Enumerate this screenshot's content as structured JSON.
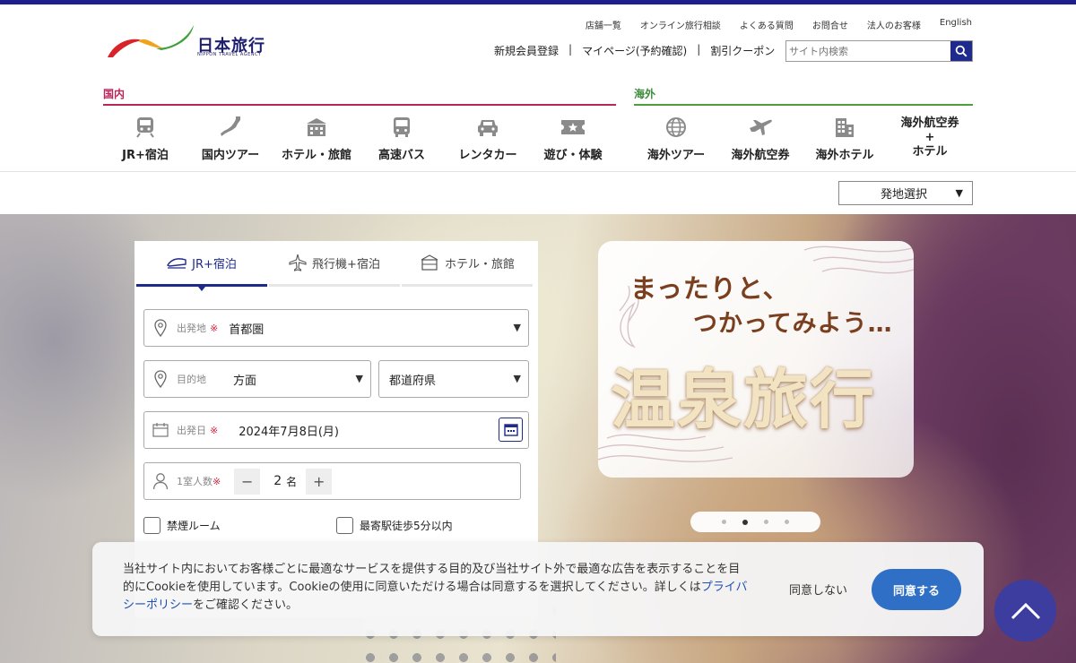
{
  "brand": {
    "name": "日本旅行",
    "sub": "NIPPON TRAVEL AGENCY"
  },
  "util_links": [
    "店舗一覧",
    "オンライン旅行相談",
    "よくある質問",
    "お問合せ",
    "法人のお客様",
    "English"
  ],
  "member_links": [
    "新規会員登録",
    "マイページ(予約確認)",
    "割引クーポン"
  ],
  "search": {
    "placeholder": "サイト内検索"
  },
  "nav": {
    "domestic_label": "国内",
    "intl_label": "海外",
    "domestic": [
      {
        "label": "JR+宿泊",
        "icon": "train-icon"
      },
      {
        "label": "国内ツアー",
        "icon": "japan-map-icon"
      },
      {
        "label": "ホテル・旅館",
        "icon": "hotel-icon"
      },
      {
        "label": "高速バス",
        "icon": "bus-icon"
      },
      {
        "label": "レンタカー",
        "icon": "car-icon"
      },
      {
        "label": "遊び・体験",
        "icon": "ticket-icon"
      }
    ],
    "intl": [
      {
        "label": "海外ツアー",
        "icon": "globe-icon"
      },
      {
        "label": "海外航空券",
        "icon": "airplane-icon"
      },
      {
        "label": "海外ホテル",
        "icon": "building-icon"
      },
      {
        "label": "海外航空券\n+\nホテル",
        "icon": ""
      }
    ]
  },
  "departure_select": {
    "value": "発地選択"
  },
  "search_panel": {
    "tabs": [
      "JR+宿泊",
      "飛行機+宿泊",
      "ホテル・旅館"
    ],
    "active_tab": 0,
    "departure": {
      "label": "出発地",
      "required": "※",
      "value": "首都圏"
    },
    "destination": {
      "label": "目的地",
      "area": "方面",
      "prefecture": "都道府県"
    },
    "date": {
      "label": "出発日",
      "required": "※",
      "value": "2024年7月8日(月)"
    },
    "guests": {
      "label": "1室人数",
      "required": "※",
      "count": "2",
      "unit": "名",
      "minus": "−",
      "plus": "+"
    },
    "options": [
      "禁煙ルーム",
      "最寄駅徒歩5分以内"
    ]
  },
  "banner": {
    "line1": "まったりと、",
    "line2": "つかってみよう…",
    "title": "温泉旅行"
  },
  "carousel": {
    "count": 4,
    "active": 1
  },
  "cookie": {
    "text": "当社サイト内においてお客様ごとに最適なサービスを提供する目的及び当社サイト外で最適な広告を表示することを目的にCookieを使用しています。Cookieの使用に同意いただける場合は同意するを選択してください。詳しくは",
    "link": "プライバシーポリシー",
    "text_after": "をご確認ください。",
    "decline": "同意しない",
    "accept": "同意する"
  },
  "colors": {
    "navy": "#1e2a8c",
    "domestic": "#b8265a",
    "intl": "#4e9e3a",
    "accept": "#2f6fc6",
    "totop": "#3c3d9e"
  }
}
